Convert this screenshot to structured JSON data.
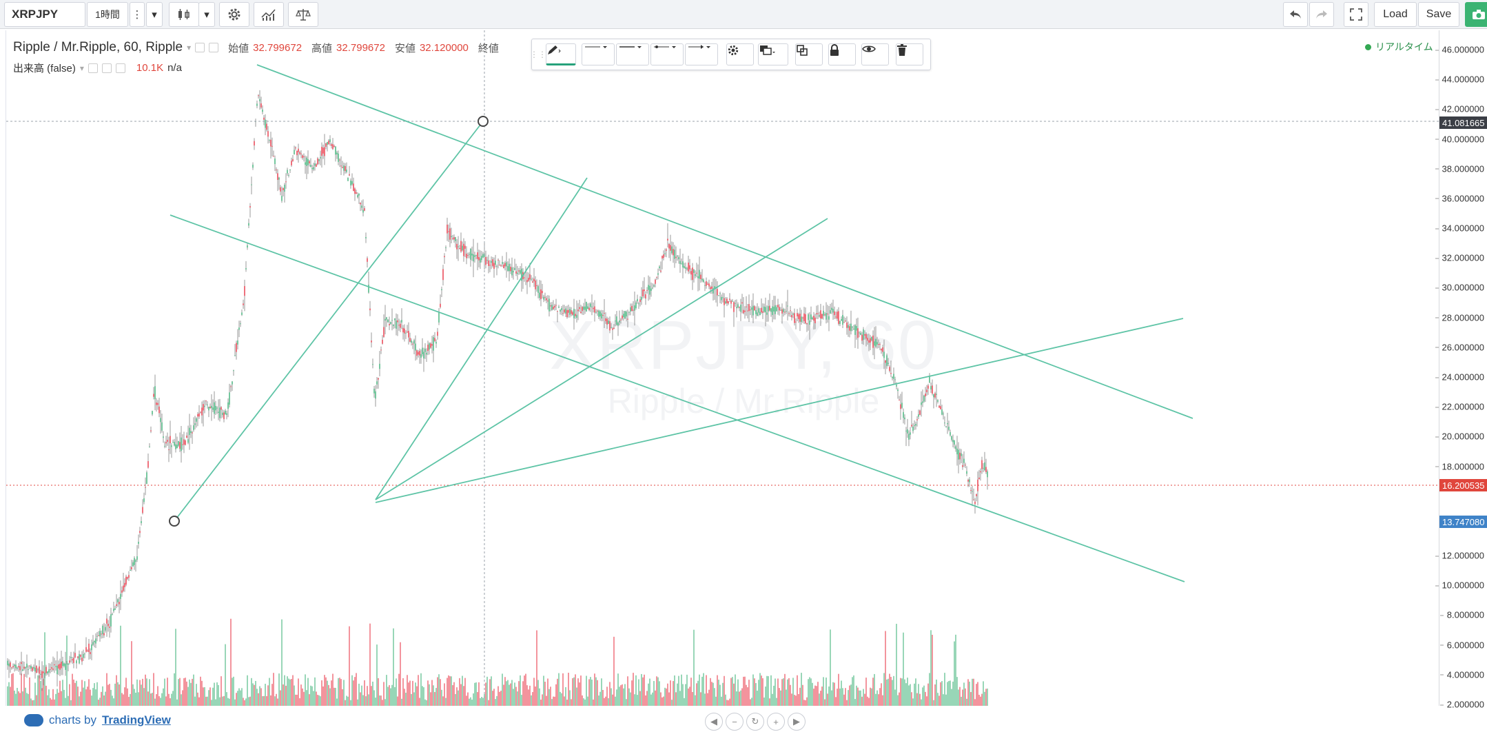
{
  "toolbar": {
    "symbol": "XRPJPY",
    "interval": "1時間",
    "load_label": "Load",
    "save_label": "Save"
  },
  "legend": {
    "title": "Ripple / Mr.Ripple, 60, Ripple",
    "open_label": "始値",
    "open_value": "32.799672",
    "high_label": "高値",
    "high_value": "32.799672",
    "low_label": "安値",
    "low_value": "32.120000",
    "close_label": "終値",
    "volume_label": "出来高 (false)",
    "volume_value": "10.1K",
    "volume_na": "n/a",
    "realtime": "リアルタイム"
  },
  "watermark": {
    "symbol": "XRPJPY, 60",
    "description": "Ripple / Mr.Ripple"
  },
  "price_axis": {
    "ticks": [
      "46.000000",
      "44.000000",
      "42.000000",
      "40.000000",
      "38.000000",
      "36.000000",
      "34.000000",
      "32.000000",
      "30.000000",
      "28.000000",
      "26.000000",
      "24.000000",
      "22.000000",
      "20.000000",
      "18.000000",
      "12.000000",
      "10.000000",
      "8.000000",
      "6.000000",
      "4.000000",
      "2.000000"
    ],
    "crosshair_price": "41.081665",
    "last_price": "16.200535",
    "blue_price": "13.747080"
  },
  "brand": {
    "prefix": "charts by",
    "name": "TradingView"
  },
  "colors": {
    "trendline": "#5ec4a6",
    "up_candle": "#53b987",
    "down_candle": "#eb4d5c",
    "last_price": "#e0463c",
    "blue_tag": "#3f83c8",
    "realtime_dot": "#33a853"
  },
  "icons": {
    "more": "vertical-dots-icon",
    "chevron": "chevron-down-icon",
    "candles": "candlestick-icon",
    "settings": "gear-icon",
    "indicators": "indicators-icon",
    "compare": "scales-icon",
    "undo": "undo-icon",
    "redo": "redo-icon",
    "fullscreen": "fullscreen-icon",
    "camera": "camera-icon",
    "pen": "pen-icon",
    "lock": "lock-icon",
    "eye": "eye-icon",
    "trash": "trash-icon"
  }
}
